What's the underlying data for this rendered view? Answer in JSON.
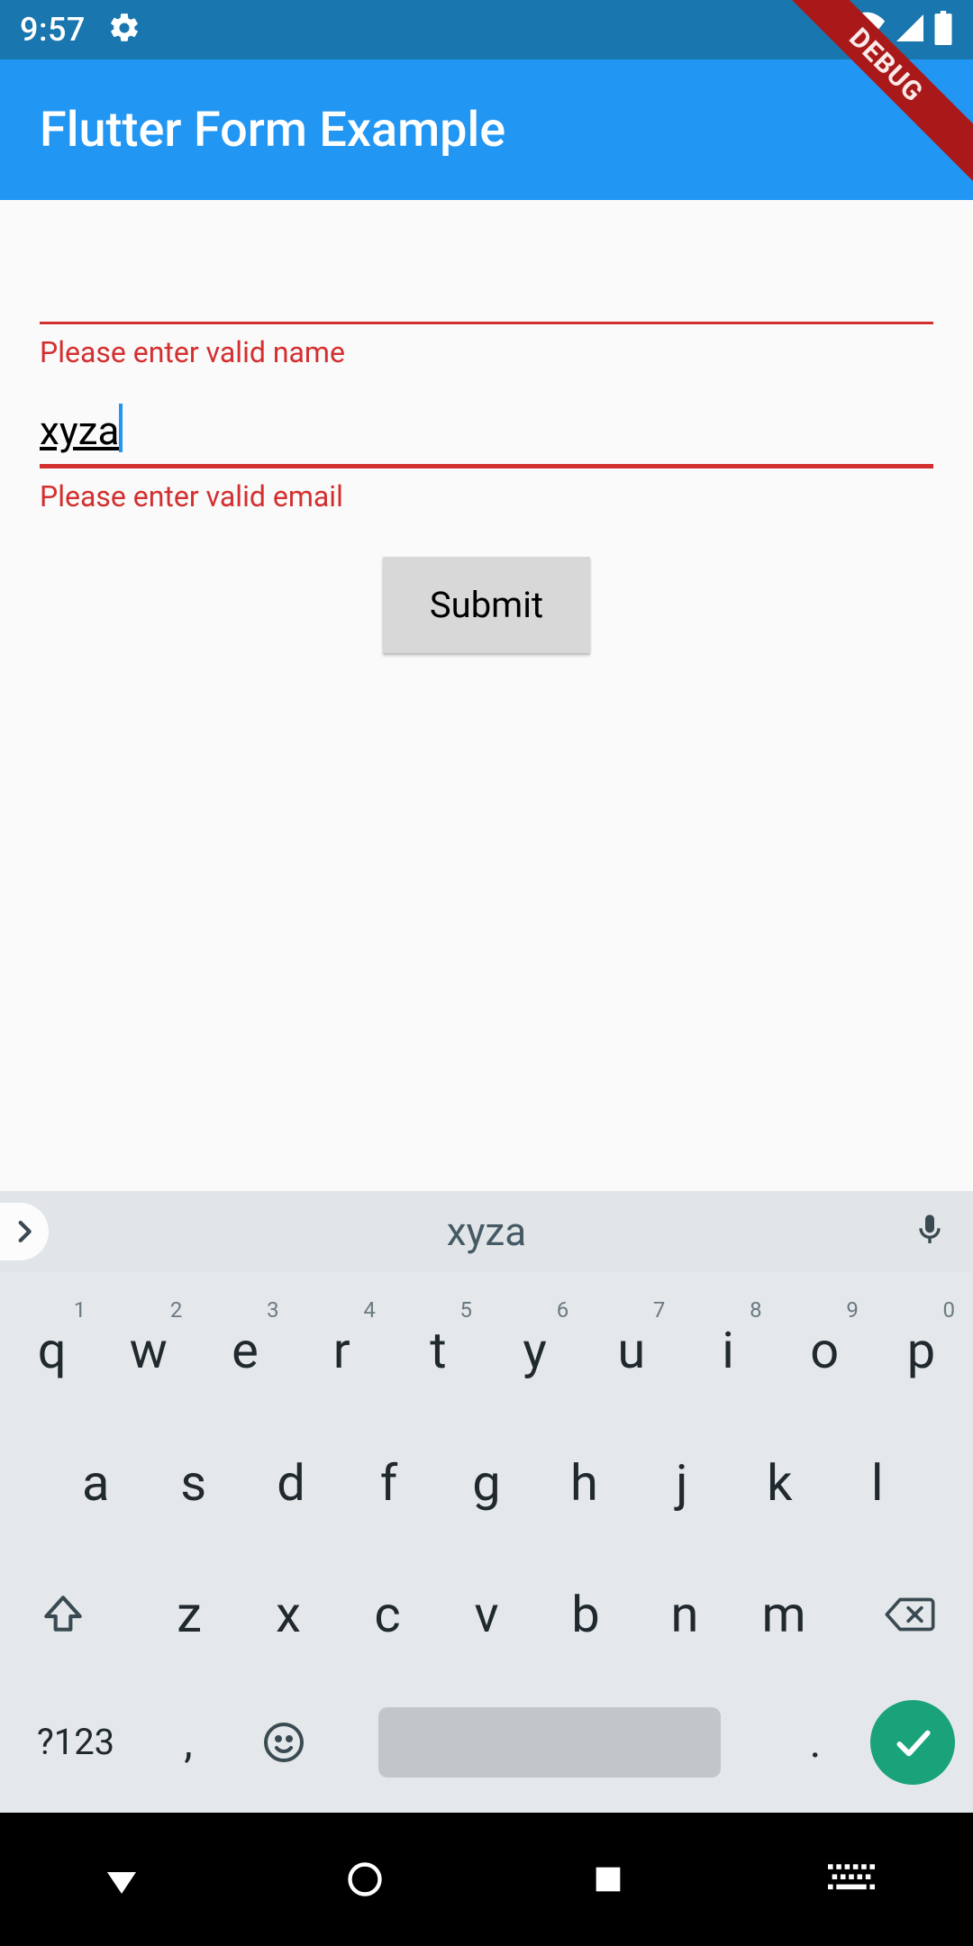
{
  "status": {
    "time": "9:57"
  },
  "debug_banner": "DEBUG",
  "app": {
    "title": "Flutter Form Example"
  },
  "form": {
    "name": {
      "value": "",
      "error": "Please enter valid name"
    },
    "email": {
      "value": "xyza",
      "error": "Please enter valid email"
    },
    "submit_label": "Submit"
  },
  "keyboard": {
    "suggestion": "xyza",
    "row1": [
      {
        "k": "q",
        "s": "1"
      },
      {
        "k": "w",
        "s": "2"
      },
      {
        "k": "e",
        "s": "3"
      },
      {
        "k": "r",
        "s": "4"
      },
      {
        "k": "t",
        "s": "5"
      },
      {
        "k": "y",
        "s": "6"
      },
      {
        "k": "u",
        "s": "7"
      },
      {
        "k": "i",
        "s": "8"
      },
      {
        "k": "o",
        "s": "9"
      },
      {
        "k": "p",
        "s": "0"
      }
    ],
    "row2": [
      "a",
      "s",
      "d",
      "f",
      "g",
      "h",
      "j",
      "k",
      "l"
    ],
    "row3": [
      "z",
      "x",
      "c",
      "v",
      "b",
      "n",
      "m"
    ],
    "symbols_label": "?123",
    "comma": ",",
    "period": "."
  }
}
